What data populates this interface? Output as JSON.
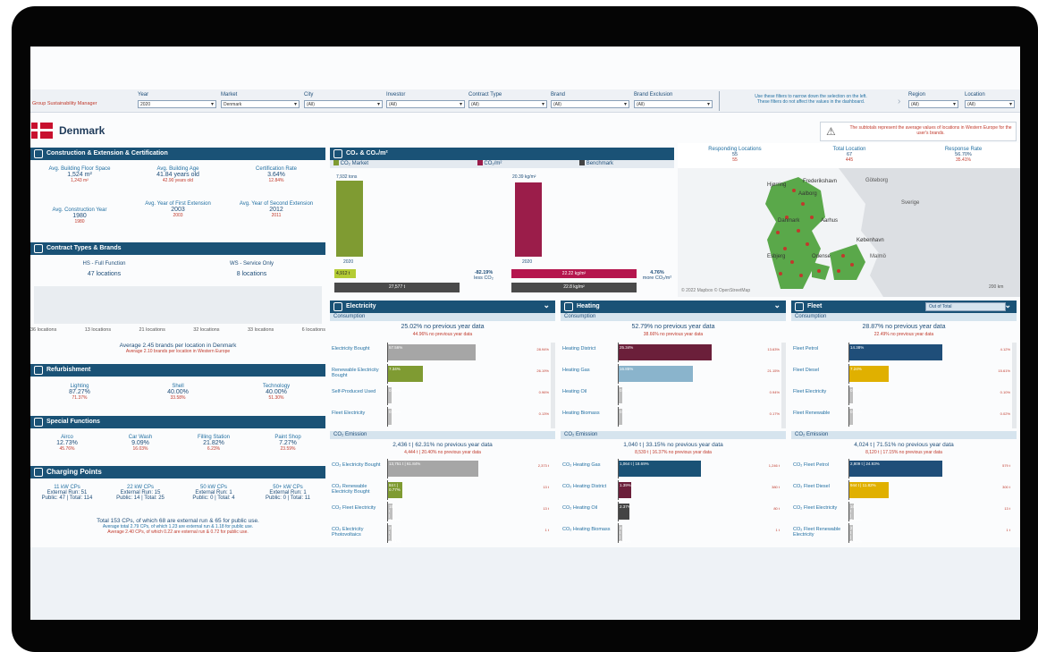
{
  "app": {
    "role_label": "Group Sustainability Manager",
    "country": "Denmark"
  },
  "filters": [
    {
      "label": "Year",
      "value": "2020"
    },
    {
      "label": "Market",
      "value": "Denmark"
    },
    {
      "label": "City",
      "value": "(All)"
    },
    {
      "label": "Investor",
      "value": "(All)"
    },
    {
      "label": "Contract Type",
      "value": "(All)"
    },
    {
      "label": "Brand",
      "value": "(All)"
    },
    {
      "label": "Brand Exclusion",
      "value": "(All)"
    }
  ],
  "filter_note": {
    "line1": "Use these filters to narrow down the selection on the left.",
    "line2": "These filters do not affect the values in the dashboard."
  },
  "right_filters": [
    {
      "label": "Region",
      "value": "(All)"
    },
    {
      "label": "Location",
      "value": "(All)"
    }
  ],
  "subtotal_note": "The subtotals represent the average values of locations in Western Europe for the user's brands.",
  "construction": {
    "title": "Construction & Extension & Certification",
    "kpis": [
      {
        "t": "Avg. Building Floor Space",
        "v": "1,524 m²",
        "r": "1,243 m²"
      },
      {
        "t": "Avg. Building Age",
        "v": "41.84 years old",
        "r": "42.90 years old"
      },
      {
        "t": "Certification Rate",
        "v": "3.64%",
        "r": "12.84%"
      },
      {
        "t": "Avg. Construction Year",
        "v": "1980",
        "r": "1980"
      },
      {
        "t": "Avg. Year of First Extension",
        "v": "2003",
        "r": "2003"
      },
      {
        "t": "Avg. Year of Second Extension",
        "v": "2012",
        "r": "2011"
      }
    ]
  },
  "contract": {
    "title": "Contract Types & Brands",
    "types": [
      {
        "name": "HS - Full Function",
        "count": "47 locations"
      },
      {
        "name": "WS - Service Only",
        "count": "8 locations"
      }
    ],
    "brand_counts": [
      "36 locations",
      "13 locations",
      "21 locations",
      "32 locations",
      "33 locations",
      "6 locations"
    ],
    "avg": "Average 2.45 brands per location in Denmark",
    "avg_r": "Average 2.10 brands per location in Western Europe"
  },
  "refurb": {
    "title": "Refurbishment",
    "items": [
      {
        "t": "Lighting",
        "v": "87.27%",
        "r": "71.37%"
      },
      {
        "t": "Shell",
        "v": "40.00%",
        "r": "33.58%"
      },
      {
        "t": "Technology",
        "v": "40.00%",
        "r": "51.30%"
      }
    ]
  },
  "special": {
    "title": "Special Functions",
    "items": [
      {
        "t": "Airco",
        "v": "12.73%",
        "r": "45.76%"
      },
      {
        "t": "Car Wash",
        "v": "9.09%",
        "r": "16.03%"
      },
      {
        "t": "Filling Station",
        "v": "21.82%",
        "r": "6.23%"
      },
      {
        "t": "Paint Shop",
        "v": "7.27%",
        "r": "23.59%"
      }
    ]
  },
  "charging": {
    "title": "Charging Points",
    "items": [
      {
        "t": "11 kW CPs",
        "a": "External Run: 51",
        "b": "Public: 47 | Total: 114"
      },
      {
        "t": "22 kW CPs",
        "a": "External Run: 15",
        "b": "Public: 14 | Total: 25"
      },
      {
        "t": "50 kW CPs",
        "a": "External Run: 1",
        "b": "Public: 0 | Total: 4"
      },
      {
        "t": "50+ kW CPs",
        "a": "External Run: 1",
        "b": "Public: 0 | Total: 11"
      }
    ],
    "total": "Total 153 CPs, of which 68 are external run & 65 for public use.",
    "avg1": "Average total 2.79 CPs, of which 1.23 are external run & 1.18 for public use.",
    "avg2": "Average 2.40 CPs, of which 0.22 are external run & 0.72 for public use."
  },
  "co2": {
    "title": "CO₂ & CO₂/m²",
    "legend": [
      "CO₂ Market",
      "CO₂/m²",
      "Benchmark"
    ],
    "left_top": "7,932 tons",
    "left_year": "2020",
    "left_val": "4,912 t",
    "left_bench": "27,577 t",
    "left_pct": "-82.19%",
    "left_pct_s": "less CO₂",
    "right_top": "20.39 kg/m²",
    "right_year": "2020",
    "right_val": "22.22 kg/m²",
    "right_bench": "22.8 kg/m²",
    "right_pct": "4.76%",
    "right_pct_s": "more CO₂/m²"
  },
  "map": {
    "stats": [
      {
        "t": "Responding Locations",
        "v": "55",
        "r": "55"
      },
      {
        "t": "Total Location",
        "v": "67",
        "r": "445"
      },
      {
        "t": "Response Rate",
        "v": "56.70%",
        "r": "35.41%"
      }
    ],
    "cities": [
      "Frederikshavn",
      "Hjørring",
      "Aalborg",
      "Göteborg",
      "Sverige",
      "Aarhus",
      "Danmark",
      "København",
      "Malmö",
      "Esbjerg",
      "Odense"
    ],
    "credit": "© 2022 Mapbox © OpenStreetMap",
    "scale": "200 km"
  },
  "panels": [
    {
      "title": "Electricity",
      "consumption": "Consumption",
      "cons_main": "25.02% no previous year data",
      "cons_sub": "44.96% no previous year data",
      "rows": [
        {
          "l": "Electricity Bought",
          "bar": "57.56%",
          "c": "#a6a6a6",
          "w": 0.85,
          "r": "28.94%"
        },
        {
          "l": "Renewable Electricity Bought",
          "bar": "7.34%",
          "c": "#7f9b32",
          "w": 0.34,
          "r": "26.19%"
        },
        {
          "l": "Self-Produced Used",
          "bar": "0.30%",
          "c": "#bfbfbf",
          "w": 0.03,
          "r": "0.96%"
        },
        {
          "l": "Fleet Electricity",
          "bar": "0.05%",
          "c": "#bfbfbf",
          "w": 0.02,
          "r": "0.13%"
        }
      ],
      "emission": "CO₂ Emission",
      "em_main": "2,436 t | 62.31% no previous year data",
      "em_sub": "4,444 t | 20.40% no previous year data",
      "em_rows": [
        {
          "l": "CO₂ Electricity Bought",
          "bar": "13,751 t | 61.84%",
          "c": "#a6a6a6",
          "w": 0.88,
          "r": "2,373 t"
        },
        {
          "l": "CO₂ Renewable Electricity Bought",
          "bar": "84 t | 0.77%",
          "c": "#7f9b32",
          "w": 0.14,
          "r": "13 t"
        },
        {
          "l": "CO₂ Fleet Electricity",
          "bar": "15 t | 0.12%",
          "c": "#bfbfbf",
          "w": 0.04,
          "r": "13 t"
        },
        {
          "l": "CO₂ Electricity Photovoltaics",
          "bar": "2 t | 0.01%",
          "c": "#bfbfbf",
          "w": 0.02,
          "r": "1 t"
        }
      ]
    },
    {
      "title": "Heating",
      "consumption": "Consumption",
      "cons_main": "52.79% no previous year data",
      "cons_sub": "38.66% no previous year data",
      "rows": [
        {
          "l": "Heating District",
          "bar": "25.34%",
          "c": "#6b1f3a",
          "w": 0.9,
          "r": "13.63%"
        },
        {
          "l": "Heating Gas",
          "bar": "16.85%",
          "c": "#8ab4cc",
          "w": 0.72,
          "r": "21.15%"
        },
        {
          "l": "Heating Oil",
          "bar": "0.52%",
          "c": "#bfbfbf",
          "w": 0.03,
          "r": "0.94%"
        },
        {
          "l": "Heating Biomass",
          "bar": "0.34%",
          "c": "#bfbfbf",
          "w": 0.02,
          "r": "0.17%"
        }
      ],
      "emission": "CO₂ Emission",
      "em_main": "1,040 t | 33.15% no previous year data",
      "em_sub": "8,539 t | 16.37% no previous year data",
      "em_rows": [
        {
          "l": "CO₂ Heating Gas",
          "bar": "1,064 t | 18.69%",
          "c": "#1a5276",
          "w": 0.8,
          "r": "1,246 t"
        },
        {
          "l": "CO₂ Heating District",
          "bar": "1.39%",
          "c": "#6b1f3a",
          "w": 0.12,
          "r": "380 t"
        },
        {
          "l": "CO₂ Heating Oil",
          "bar": "2.37%",
          "c": "#444",
          "w": 0.1,
          "r": "80 t"
        },
        {
          "l": "CO₂ Heating Biomass",
          "bar": "4 t | 0.03%",
          "c": "#bfbfbf",
          "w": 0.03,
          "r": "1 t"
        }
      ]
    },
    {
      "title": "Fleet",
      "consumption": "Consumption",
      "cons_main": "28.87% no previous year data",
      "cons_sub": "22.49% no previous year data",
      "rows": [
        {
          "l": "Fleet Petrol",
          "bar": "14.38%",
          "c": "#1f4e79",
          "w": 0.9,
          "r": "4.12%"
        },
        {
          "l": "Fleet Diesel",
          "bar": "7.24%",
          "c": "#e0b000",
          "w": 0.38,
          "r": "15.61%"
        },
        {
          "l": "Fleet Electricity",
          "bar": "0.02%",
          "c": "#bfbfbf",
          "w": 0.02,
          "r": "0.10%"
        },
        {
          "l": "Fleet Renewable",
          "bar": "0.12%",
          "c": "#bfbfbf",
          "w": 0.02,
          "r": "0.02%"
        }
      ],
      "emission": "CO₂ Emission",
      "em_main": "4,024 t | 71.51% no previous year data",
      "em_sub": "8,120 t | 17.15% no previous year data",
      "em_rows": [
        {
          "l": "CO₂ Fleet Petrol",
          "bar": "2,809 t | 24.93%",
          "c": "#1f4e79",
          "w": 0.9,
          "r": "579 t"
        },
        {
          "l": "CO₂ Fleet Diesel",
          "bar": "944 t | 11.82%",
          "c": "#e0b000",
          "w": 0.38,
          "r": "300 t"
        },
        {
          "l": "CO₂ Fleet Electricity",
          "bar": "16 t | 0.19%",
          "c": "#bfbfbf",
          "w": 0.04,
          "r": "13 t"
        },
        {
          "l": "CO₂ Fleet Renewable Electricity",
          "bar": "2 t | 0.02%",
          "c": "#bfbfbf",
          "w": 0.02,
          "r": "1 t"
        }
      ]
    }
  ],
  "fleet_select": "Out of Total",
  "colors": {
    "header": "#1a5276",
    "accent": "#c0392b",
    "green": "#7f9b32",
    "maroon": "#9b1d4a"
  }
}
